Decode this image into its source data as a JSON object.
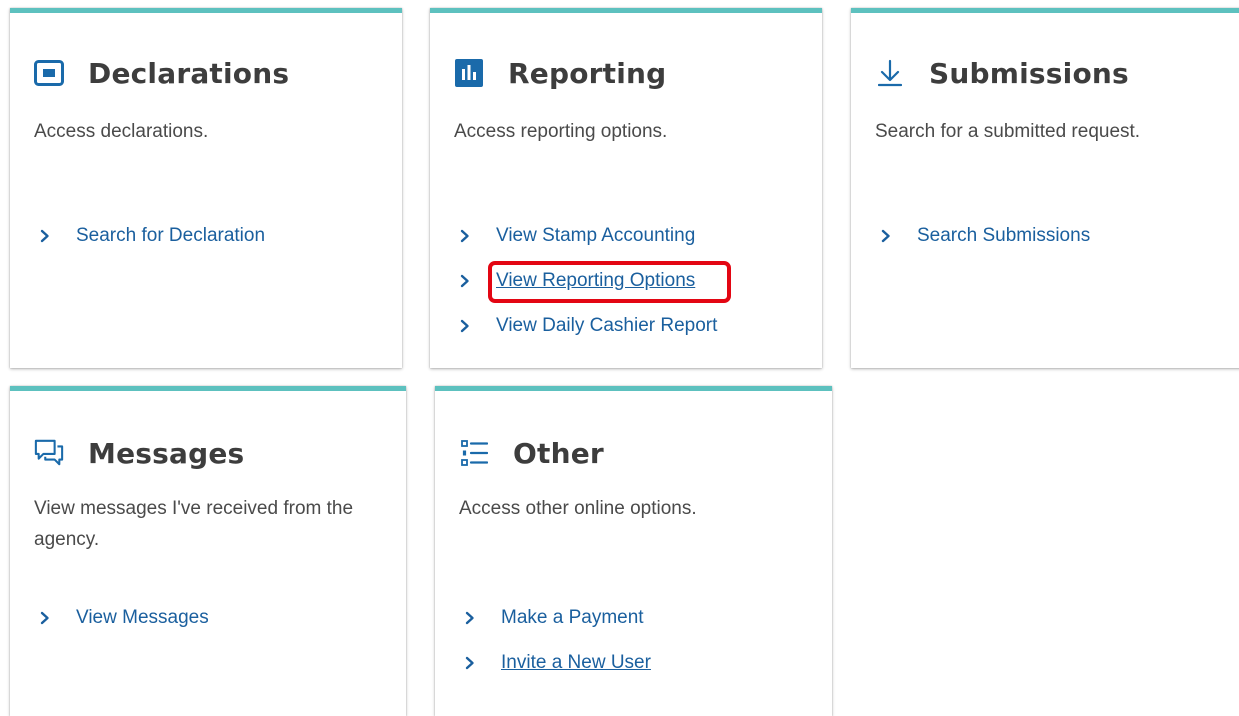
{
  "colors": {
    "accent_bar": "#5dc1bf",
    "icon_blue": "#1a6aaa",
    "link_blue": "#1a5f9e",
    "title_text": "#3d3d3d",
    "body_text": "#4a4a4a",
    "highlight_red": "#e30613"
  },
  "cards": {
    "declarations": {
      "icon": "window-icon",
      "title": "Declarations",
      "description": "Access declarations.",
      "links": [
        {
          "label": "Search for Declaration",
          "underlined": false
        }
      ]
    },
    "reporting": {
      "icon": "bar-chart-icon",
      "title": "Reporting",
      "description": "Access reporting options.",
      "links": [
        {
          "label": "View Stamp Accounting",
          "underlined": false
        },
        {
          "label": "View Reporting Options",
          "underlined": true,
          "highlighted": true
        },
        {
          "label": "View Daily Cashier Report",
          "underlined": false
        }
      ]
    },
    "submissions": {
      "icon": "download-arrow-icon",
      "title": "Submissions",
      "description": "Search for a submitted request.",
      "links": [
        {
          "label": "Search Submissions",
          "underlined": false
        }
      ]
    },
    "messages": {
      "icon": "chat-bubbles-icon",
      "title": "Messages",
      "description": "View messages I've received from the agency.",
      "links": [
        {
          "label": "View Messages",
          "underlined": false
        }
      ]
    },
    "other": {
      "icon": "list-icon",
      "title": "Other",
      "description": "Access other online options.",
      "links": [
        {
          "label": "Make a Payment",
          "underlined": false
        },
        {
          "label": "Invite a New User",
          "underlined": true
        }
      ]
    }
  }
}
